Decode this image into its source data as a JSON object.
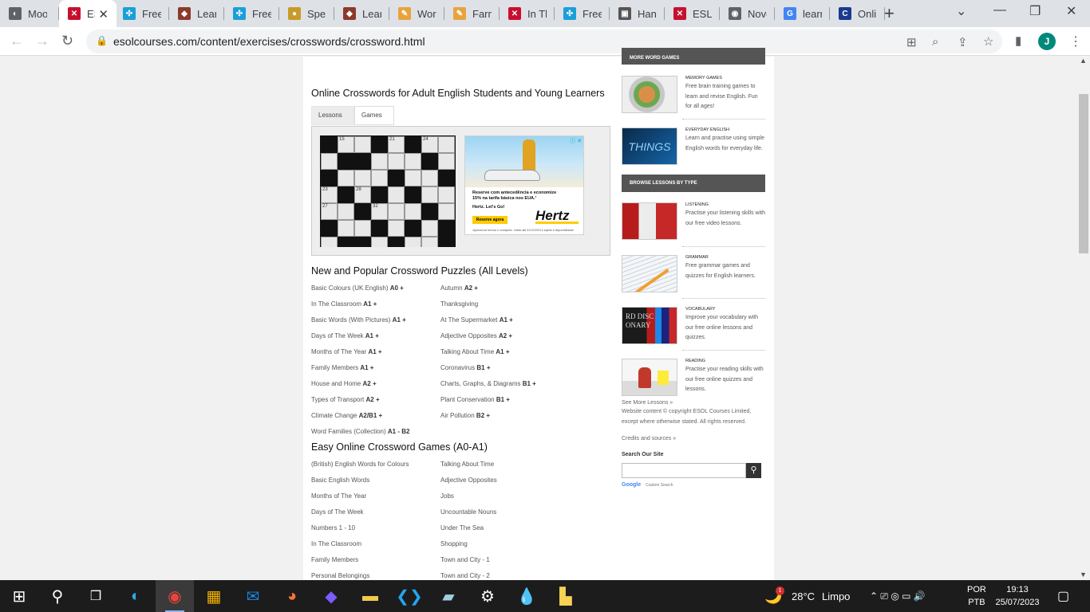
{
  "browser": {
    "tabs": [
      {
        "title": "Moon",
        "favicon_color": "#5f6368",
        "favicon_glyph": "◐"
      },
      {
        "title": "ESL C",
        "favicon_color": "#c8102e",
        "favicon_glyph": "✕",
        "active": true
      },
      {
        "title": "Freer",
        "favicon_color": "#1a9fd8",
        "favicon_glyph": "✣"
      },
      {
        "title": "Learn",
        "favicon_color": "#8b3a2b",
        "favicon_glyph": "◆"
      },
      {
        "title": "Freer",
        "favicon_color": "#1a9fd8",
        "favicon_glyph": "✣"
      },
      {
        "title": "Spelli",
        "favicon_color": "#c79a2a",
        "favicon_glyph": "●"
      },
      {
        "title": "Learn",
        "favicon_color": "#8b3a2b",
        "favicon_glyph": "◆"
      },
      {
        "title": "Word",
        "favicon_color": "#e8a33d",
        "favicon_glyph": "✎"
      },
      {
        "title": "Farm",
        "favicon_color": "#e8a33d",
        "favicon_glyph": "✎"
      },
      {
        "title": "In Th",
        "favicon_color": "#c8102e",
        "favicon_glyph": "✕"
      },
      {
        "title": "Freer",
        "favicon_color": "#1a9fd8",
        "favicon_glyph": "✣"
      },
      {
        "title": "Hang",
        "favicon_color": "#555555",
        "favicon_glyph": "▣"
      },
      {
        "title": "ESL C",
        "favicon_color": "#c8102e",
        "favicon_glyph": "✕"
      },
      {
        "title": "Novo",
        "favicon_color": "#5f6368",
        "favicon_glyph": "◉"
      },
      {
        "title": "learn",
        "favicon_color": "#4285f4",
        "favicon_glyph": "G"
      },
      {
        "title": "Onlin",
        "favicon_color": "#1a3a8f",
        "favicon_glyph": "C"
      }
    ],
    "tab_close_glyph": "✕",
    "new_tab_glyph": "+",
    "window_controls": {
      "tablist": "⌄",
      "minimize": "—",
      "restore": "❐",
      "close": "✕"
    },
    "nav": {
      "back": "←",
      "forward": "→",
      "reload": "↻"
    },
    "lock_glyph": "🔒",
    "url": "esolcourses.com/content/exercises/crosswords/crossword.html",
    "toolbar_icons": {
      "translate": "⊞",
      "zoom": "⌕",
      "share": "⇪",
      "bookmark": "☆",
      "sidepanel": "▮"
    },
    "profile_initial": "J",
    "menu_glyph": "⋮"
  },
  "page": {
    "heading": "Online Crosswords for Adult English Students and Young Learners",
    "menu": {
      "lessons": "Lessons ▾",
      "games": "Games ▾"
    },
    "crossword_numbers": [
      "15",
      "20",
      "24",
      "19",
      "33",
      "23",
      "28",
      "27",
      "32",
      "21"
    ],
    "ad": {
      "info_glyph": "ⓘ ✕",
      "line1": "Reserve com antecedência e economize",
      "line2": "15% na tarifa básica nos EUA.¹",
      "line3": "Hertz. Let's Go!",
      "cta": "Reserve agora",
      "logo": "Hertz",
      "fine": "¹Aplicam-se termos e condições. Válido até 31/12/2023 e sujeito à disponibilidade."
    },
    "section1": {
      "title": "New and Popular Crossword Puzzles (All Levels)",
      "left": [
        {
          "text": "Basic Colours (UK English)",
          "level": "A0 +"
        },
        {
          "text": "In The Classroom",
          "level": "A1 +"
        },
        {
          "text": "Basic Words (With Pictures)",
          "level": "A1 +"
        },
        {
          "text": "Days of The Week",
          "level": "A1 +"
        },
        {
          "text": "Months of The Year",
          "level": "A1 +"
        },
        {
          "text": "Family Members",
          "level": "A1 +"
        },
        {
          "text": "House and Home",
          "level": "A2 +"
        },
        {
          "text": "Types of Transport",
          "level": "A2 +"
        },
        {
          "text": "Climate Change",
          "level": "A2/B1 +"
        },
        {
          "text": "Word Families (Collection)",
          "level": "A1 - B2"
        }
      ],
      "right": [
        {
          "text": "Autumn",
          "level": "A2 +"
        },
        {
          "text": "Thanksgiving",
          "level": ""
        },
        {
          "text": "At The Supermarket",
          "level": "A1 +"
        },
        {
          "text": "Adjective Opposites",
          "level": "A2 +"
        },
        {
          "text": "Talking About Time",
          "level": "A1 +"
        },
        {
          "text": "Coronavirus",
          "level": "B1 +"
        },
        {
          "text": "Charts, Graphs, & Diagrams",
          "level": "B1 +"
        },
        {
          "text": "Plant Conservation",
          "level": "B1 +"
        },
        {
          "text": "Air Pollution",
          "level": "B2 +"
        }
      ]
    },
    "section2": {
      "title": "Easy Online Crossword Games (A0-A1)",
      "left": [
        "(British) English Words for Colours",
        "Basic English Words",
        "Months of The Year",
        "Days of The Week",
        "Numbers 1 - 10",
        "In The Classroom",
        "Family Members",
        "Personal Belongings"
      ],
      "right": [
        "Talking About Time",
        "Adjective Opposites",
        "Jobs",
        "Uncountable Nouns",
        "Under The Sea",
        "Shopping",
        "Town and City - 1",
        "Town and City - 2"
      ]
    }
  },
  "sidebar": {
    "more_games_heading": "MORE WORD GAMES",
    "games": [
      {
        "title": "MEMORY GAMES",
        "desc": "Free brain training games to learn and revise English. Fun for all ages!"
      },
      {
        "title": "EVERYDAY ENGLISH",
        "desc": "Learn and practise using simple English words for everyday life.",
        "thumb_text": "THINGS"
      }
    ],
    "browse_heading": "BROWSE LESSONS BY TYPE",
    "lessons": [
      {
        "title": "LISTENING",
        "desc": "Practise your listening skills with our free video lessons."
      },
      {
        "title": "GRAMMAR",
        "desc": "Free grammar games and quizzes for English learners."
      },
      {
        "title": "VOCABULARY",
        "desc": "Improve your vocabulary with our free online lessons and quizzes.",
        "thumb_text": "RD DISC ONARY"
      },
      {
        "title": "READING",
        "desc": "Practise your reading skills with our free online quizzes and lessons."
      }
    ],
    "see_more": "See More Lessons »",
    "copyright_1": "Website content © copyright ESOL Courses Limited,",
    "copyright_2": "except where otherwise stated. All rights reserved.",
    "credits": "Credits and sources »",
    "search_label": "Search Our Site",
    "search_value": "",
    "search_glyph": "⚲",
    "google": "Google",
    "custom_search": "Custom Search"
  },
  "taskbar": {
    "start_glyph": "⊞",
    "search_glyph": "⚲",
    "taskview_glyph": "❒",
    "apps": [
      {
        "name": "edge",
        "glyph": "◐",
        "color": "#2fa8e0"
      },
      {
        "name": "chrome",
        "glyph": "◉",
        "color": "#e8453c",
        "active": true
      },
      {
        "name": "store",
        "glyph": "▦",
        "color": "#f4b400"
      },
      {
        "name": "mail",
        "glyph": "✉",
        "color": "#1e88e5"
      },
      {
        "name": "firefox",
        "glyph": "◕",
        "color": "#ff7139"
      },
      {
        "name": "clipchamp",
        "glyph": "◆",
        "color": "#7c5cff"
      },
      {
        "name": "explorer",
        "glyph": "▬",
        "color": "#f2c94c"
      },
      {
        "name": "vscode",
        "glyph": "❮❯",
        "color": "#23a6f0"
      },
      {
        "name": "notebook",
        "glyph": "▰",
        "color": "#9ecfe0"
      },
      {
        "name": "settings",
        "glyph": "⚙",
        "color": "#ffffff"
      },
      {
        "name": "paint",
        "glyph": "💧",
        "color": "#ff6aa5"
      },
      {
        "name": "files",
        "glyph": "▙",
        "color": "#f7d154"
      }
    ],
    "weather_glyph": "🌙",
    "weather_badge": "1",
    "temperature": "28°C",
    "condition": "Limpo",
    "tray_glyphs": "⌃  ⎚  ◎  ▭  🔊",
    "lang_top": "POR",
    "lang_bottom": "PTB",
    "time": "19:13",
    "date": "25/07/2023",
    "notification_glyph": "▢"
  }
}
